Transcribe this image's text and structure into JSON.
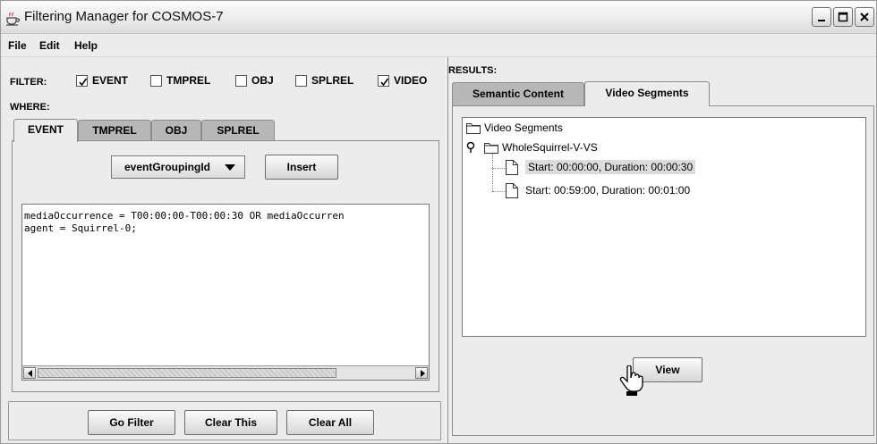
{
  "window": {
    "title": "Filtering Manager for COSMOS-7",
    "controls": [
      "minimize-icon",
      "maximize-icon",
      "close-icon"
    ]
  },
  "menubar": {
    "items": [
      "File",
      "Edit",
      "Help"
    ]
  },
  "filter": {
    "label": "FILTER:",
    "options": [
      {
        "label": "EVENT",
        "checked": true
      },
      {
        "label": "TMPREL",
        "checked": false
      },
      {
        "label": "OBJ",
        "checked": false
      },
      {
        "label": "SPLREL",
        "checked": false
      },
      {
        "label": "VIDEO",
        "checked": true
      }
    ]
  },
  "where": {
    "label": "WHERE:",
    "tabs": [
      "EVENT",
      "TMPREL",
      "OBJ",
      "SPLREL"
    ],
    "active_tab": "EVENT",
    "dropdown_value": "eventGroupingId",
    "insert_label": "Insert",
    "query_lines": [
      "mediaOccurrence = T00:00:00-T00:00:30 OR mediaOccurren",
      "agent = Squirrel-0;"
    ]
  },
  "actions": {
    "go_filter": "Go Filter",
    "clear_this": "Clear This",
    "clear_all": "Clear All"
  },
  "results": {
    "label": "RESULTS:",
    "tabs": [
      "Semantic Content",
      "Video Segments"
    ],
    "active_tab": "Video Segments",
    "tree": {
      "root": "Video Segments",
      "child": "WholeSquirrel-V-VS",
      "leaves": [
        {
          "text": "Start: 00:00:00, Duration: 00:00:30",
          "selected": true
        },
        {
          "text": "Start: 00:59:00, Duration: 00:01:00",
          "selected": false
        }
      ]
    },
    "view_label": "View"
  },
  "colors": {
    "panel": "#ececec",
    "tab_inactive": "#b7b7b7",
    "selection": "#dcdcdc"
  }
}
